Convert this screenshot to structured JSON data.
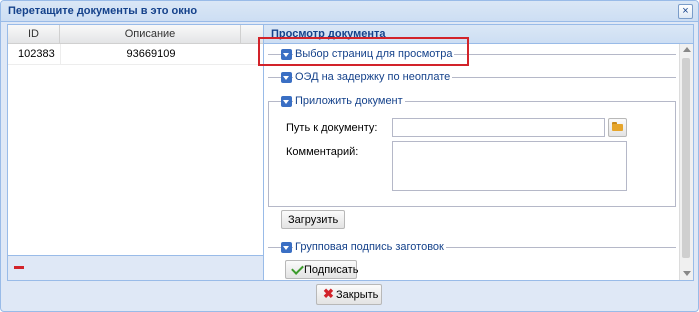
{
  "window": {
    "title": "Перетащите документы в это окно",
    "close_glyph": "×"
  },
  "grid": {
    "columns": [
      "ID",
      "Описание"
    ],
    "rows": [
      [
        "102383",
        "93669109"
      ]
    ],
    "delete_icon": "minus-icon"
  },
  "viewer": {
    "title": "Просмотр документа",
    "sections": {
      "pages": "Выбор страниц для просмотра",
      "delay": "ОЭД на задержку по неоплате",
      "attach": "Приложить документ",
      "group_sign": "Групповая подпись заготовок"
    },
    "attach_form": {
      "path_label": "Путь к документу:",
      "path_value": "",
      "comment_label": "Комментарий:",
      "comment_value": "",
      "upload_label": "Загрузить"
    },
    "sign_label": "Подписать"
  },
  "footer": {
    "close_label": "Закрыть"
  },
  "colors": {
    "accent": "#15428b",
    "highlight": "#d2232a"
  }
}
